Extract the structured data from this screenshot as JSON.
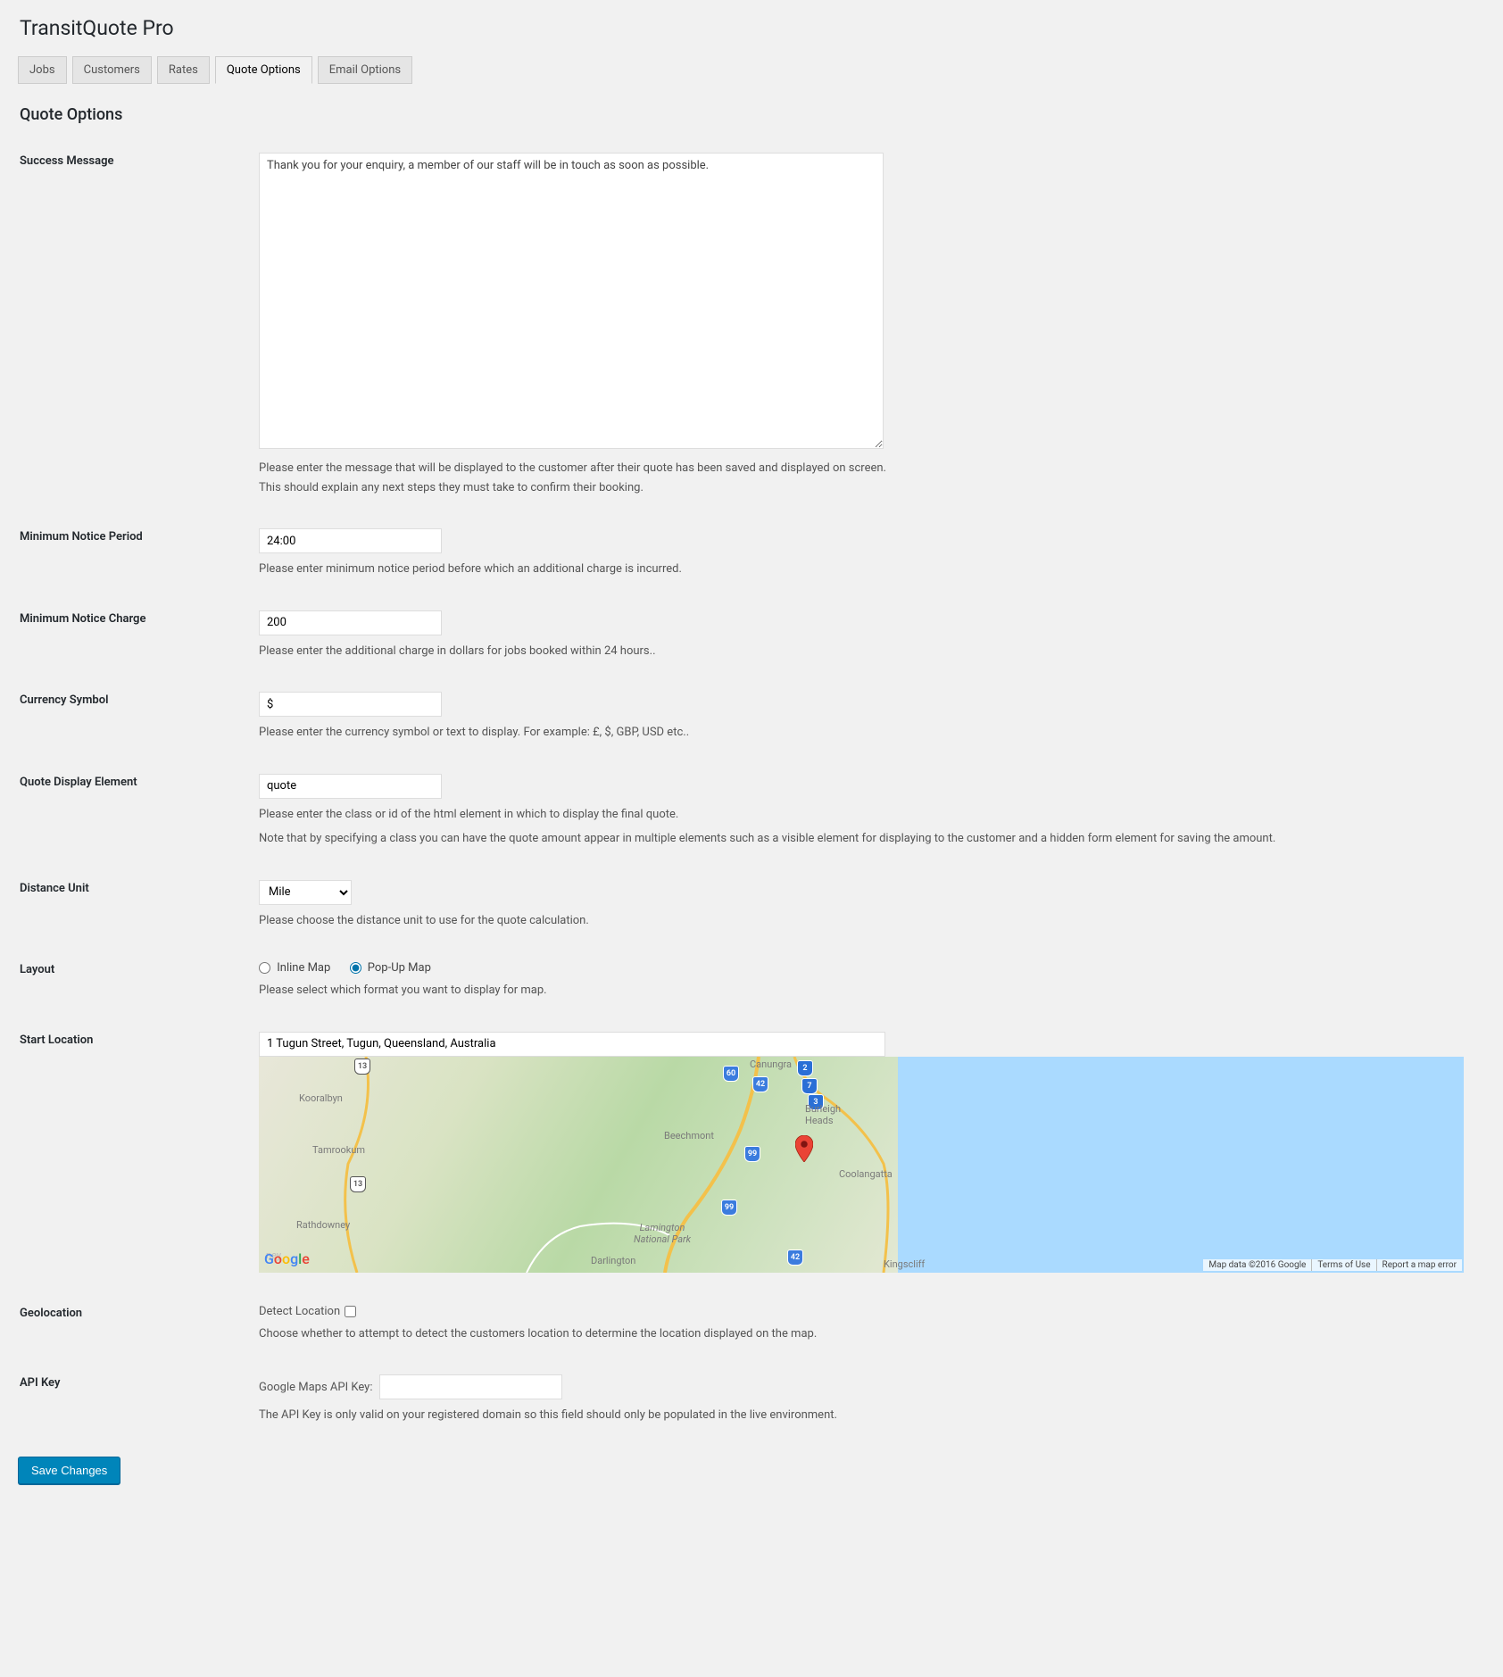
{
  "page_title": "TransitQuote Pro",
  "tabs": [
    {
      "label": "Jobs",
      "active": false
    },
    {
      "label": "Customers",
      "active": false
    },
    {
      "label": "Rates",
      "active": false
    },
    {
      "label": "Quote Options",
      "active": true
    },
    {
      "label": "Email Options",
      "active": false
    }
  ],
  "section_title": "Quote Options",
  "fields": {
    "success_message": {
      "label": "Success Message",
      "value": "Thank you for your enquiry, a member of our staff will be in touch as soon as possible.",
      "desc1": "Please enter the message that will be displayed to the customer after their quote has been saved and displayed on screen.",
      "desc2": "This should explain any next steps they must take to confirm their booking."
    },
    "min_notice_period": {
      "label": "Minimum Notice Period",
      "value": "24:00",
      "desc": "Please enter minimum notice period before which an additional charge is incurred."
    },
    "min_notice_charge": {
      "label": "Minimum Notice Charge",
      "value": "200",
      "desc": "Please enter the additional charge in dollars for jobs booked within 24 hours.."
    },
    "currency_symbol": {
      "label": "Currency Symbol",
      "value": "$",
      "desc": "Please enter the currency symbol or text to display. For example: £, $, GBP, USD etc.."
    },
    "quote_display_element": {
      "label": "Quote Display Element",
      "value": "quote",
      "desc1": "Please enter the class or id of the html element in which to display the final quote.",
      "desc2": "Note that by specifying a class you can have the quote amount appear in multiple elements such as a visible element for displaying to the customer and a hidden form element for saving the amount."
    },
    "distance_unit": {
      "label": "Distance Unit",
      "value": "Mile",
      "desc": "Please choose the distance unit to use for the quote calculation."
    },
    "layout": {
      "label": "Layout",
      "option_inline": "Inline Map",
      "option_popup": "Pop-Up Map",
      "selected": "popup",
      "desc": "Please select which format you want to display for map."
    },
    "start_location": {
      "label": "Start Location",
      "value": "1 Tugun Street, Tugun, Queensland, Australia"
    },
    "map": {
      "credits_data": "Map data ©2016 Google",
      "credits_terms": "Terms of Use",
      "credits_report": "Report a map error",
      "places": {
        "kooralbyn": "Kooralbyn",
        "tamrookum": "Tamrookum",
        "rathdowney": "Rathdowney",
        "canungra": "Canungra",
        "beechmont": "Beechmont",
        "lamington": "Lamington\nNational Park",
        "darlington": "Darlington",
        "burleigh": "Burleigh\nHeads",
        "coolangatta": "Coolangatta",
        "kingscliff": "Kingscliff"
      }
    },
    "geolocation": {
      "label": "Geolocation",
      "checkbox_label": "Detect Location",
      "checked": false,
      "desc": "Choose whether to attempt to detect the customers location to determine the location displayed on the map."
    },
    "api_key": {
      "label": "API Key",
      "inline_label": "Google Maps API Key:",
      "value": "",
      "desc": "The API Key is only valid on your registered domain so this field should only be populated in the live environment."
    }
  },
  "submit_label": "Save Changes"
}
